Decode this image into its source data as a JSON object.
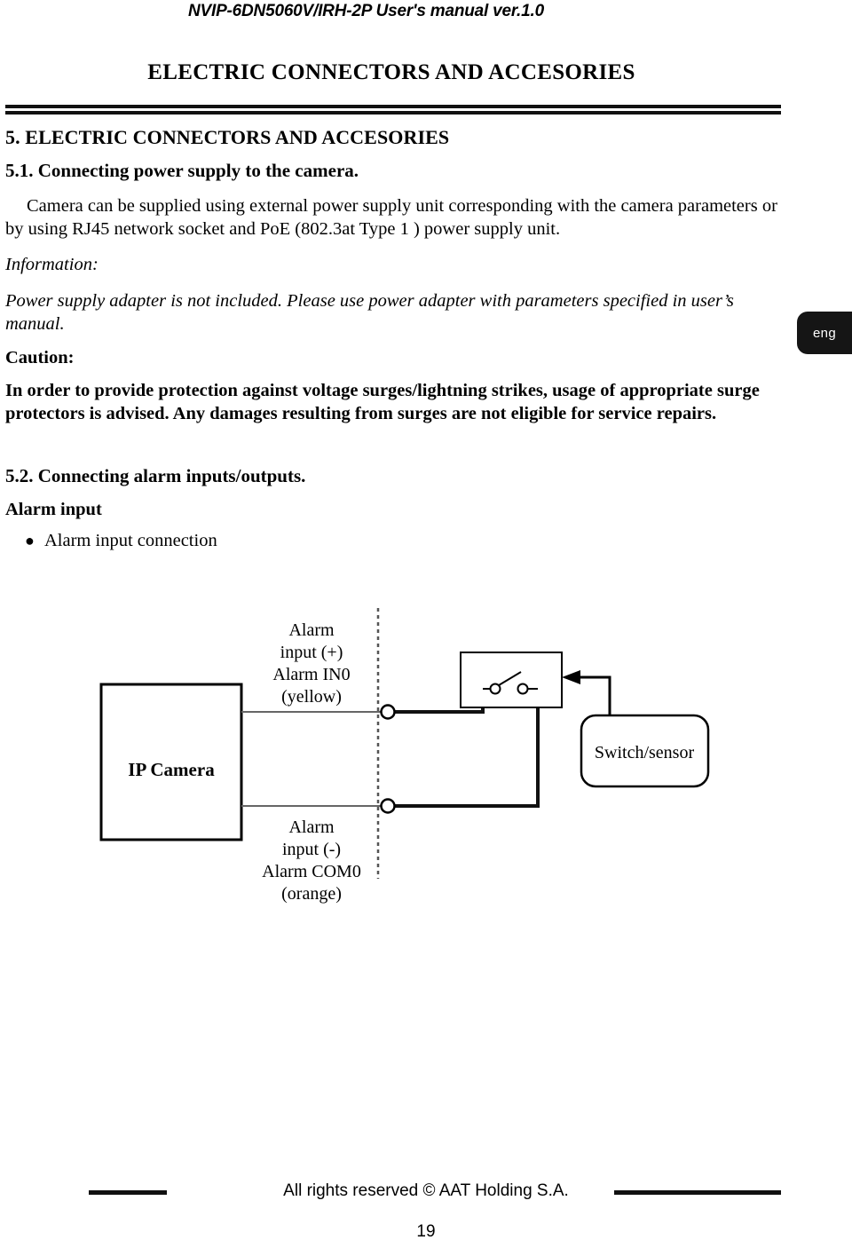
{
  "header": {
    "running_head": "NVIP-6DN5060V/IRH-2P User's manual ver.1.0",
    "chapter_title": "ELECTRIC CONNECTORS AND ACCESORIES"
  },
  "language_tab": {
    "label": "eng"
  },
  "body": {
    "section_5_title": "5. ELECTRIC CONNECTORS AND ACCESORIES",
    "section_5_1_title": "5.1. Connecting  power supply to the camera.",
    "paragraph_power": "Camera can be supplied using external power supply unit corresponding with the camera parameters or by using RJ45 network socket and PoE (802.3at Type 1 ) power supply unit.",
    "information_label": "Information:",
    "information_text": "Power supply adapter is not included. Please use power adapter with parameters specified in user’s manual.",
    "caution_label": "Caution:",
    "caution_text": "In order to provide protection against voltage surges/lightning strikes, usage of appropriate surge protectors is advised. Any damages resulting from surges are not eligible for service repairs.",
    "section_5_2_title": "5.2. Connecting alarm inputs/outputs.",
    "alarm_input_label": "Alarm input",
    "bullet_marker": "●",
    "bullet_alarm_input_connection": "Alarm input connection"
  },
  "diagram": {
    "camera_box_label": "IP Camera",
    "wire_top_label_line1": "Alarm",
    "wire_top_label_line2": "input (+)",
    "wire_top_label_line3": "Alarm IN0",
    "wire_top_label_line4": "(yellow)",
    "wire_bottom_label_line1": "Alarm",
    "wire_bottom_label_line2": "input (-)",
    "wire_bottom_label_line3": "Alarm COM0",
    "wire_bottom_label_line4": "(orange)",
    "switch_sensor_label": "Switch/sensor"
  },
  "footer": {
    "copyright": "All rights reserved © AAT Holding S.A.",
    "page_number": "19"
  }
}
